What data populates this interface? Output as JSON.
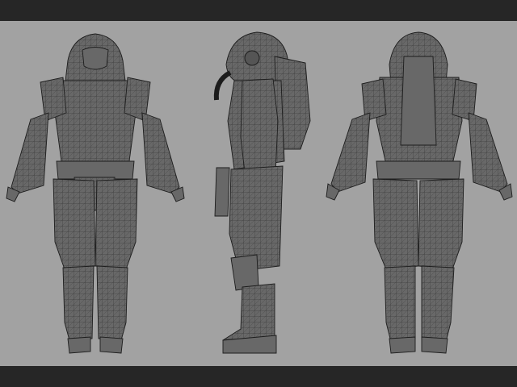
{
  "scene": {
    "background_color": "#a2a2a2",
    "letterbox_color": "#262626",
    "mesh_fill_color": "#686868",
    "wire_color": "#1c1c1c"
  },
  "views": [
    {
      "id": "front",
      "icon": "armored-suit-front-figure"
    },
    {
      "id": "side",
      "icon": "armored-suit-side-figure"
    },
    {
      "id": "back",
      "icon": "armored-suit-back-figure"
    }
  ]
}
